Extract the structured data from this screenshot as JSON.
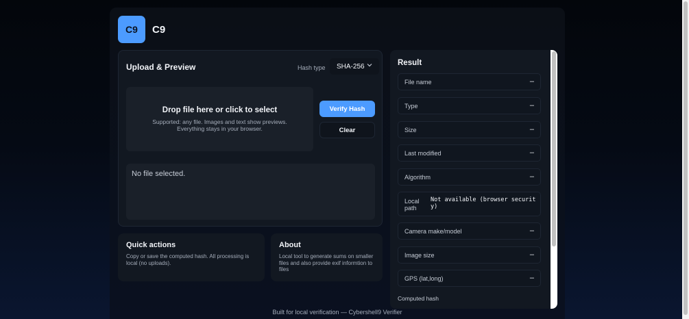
{
  "brand": {
    "logo_text": "C9",
    "name": "C9",
    "accent": "#4c9bff"
  },
  "upload": {
    "title": "Upload & Preview",
    "hash_type_label": "Hash type",
    "hash_type_value": "SHA-256",
    "dropzone_title": "Drop file here or click to select",
    "dropzone_sub": "Supported: any file. Images and text show previews. Everything stays in your browser.",
    "verify_label": "Verify Hash",
    "clear_label": "Clear",
    "preview_text": "No file selected."
  },
  "quick_actions": {
    "title": "Quick actions",
    "text": "Copy or save the computed hash. All processing is local (no uploads)."
  },
  "about": {
    "title": "About",
    "text": "Local tool to generate sums on smaller files and also provide exif informtion to files"
  },
  "result": {
    "title": "Result",
    "rows": [
      {
        "label": "File name",
        "value": "–"
      },
      {
        "label": "Type",
        "value": "–"
      },
      {
        "label": "Size",
        "value": "–"
      },
      {
        "label": "Last modified",
        "value": "–"
      },
      {
        "label": "Algorithm",
        "value": "–"
      },
      {
        "label": "Local path",
        "value": "Not available (browser security)"
      },
      {
        "label": "Camera make/model",
        "value": "–"
      },
      {
        "label": "Image size",
        "value": "–"
      },
      {
        "label": "GPS (lat,long)",
        "value": "–"
      }
    ],
    "computed_hash_label": "Computed hash"
  },
  "footer": {
    "text": "Built for local verification — Cybershell9 Verifier"
  }
}
